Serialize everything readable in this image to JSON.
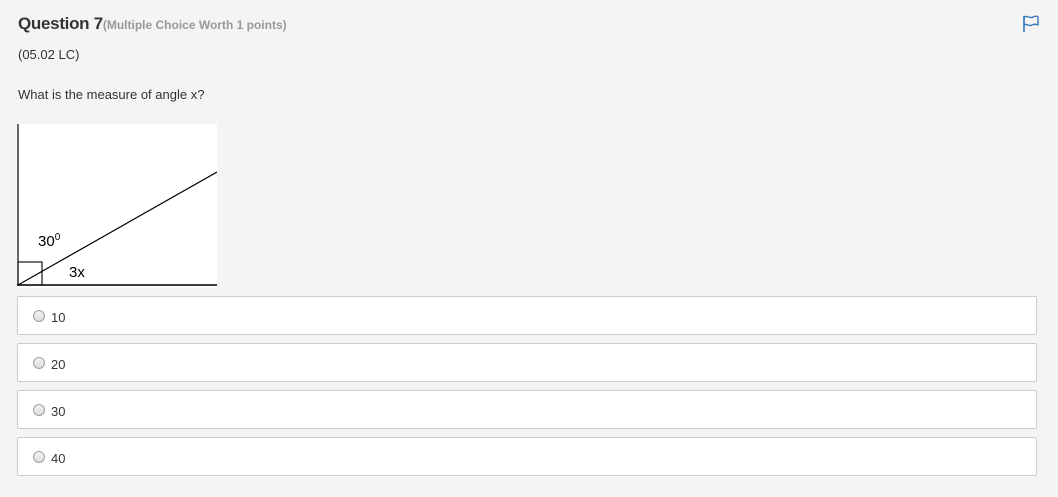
{
  "question": {
    "title": "Question 7",
    "type_info": "(Multiple Choice Worth 1 points)",
    "code": "(05.02 LC)",
    "prompt": "What is the measure of angle x?",
    "flag_icon": "flag-icon"
  },
  "figure": {
    "angle_label_value": "30",
    "angle_label_superscript": "0",
    "angle_label_x": "3x"
  },
  "answers": [
    {
      "label": "10"
    },
    {
      "label": "20"
    },
    {
      "label": "30"
    },
    {
      "label": "40"
    }
  ],
  "colors": {
    "accent": "#3a7bbf",
    "background": "#f4f4f4"
  }
}
